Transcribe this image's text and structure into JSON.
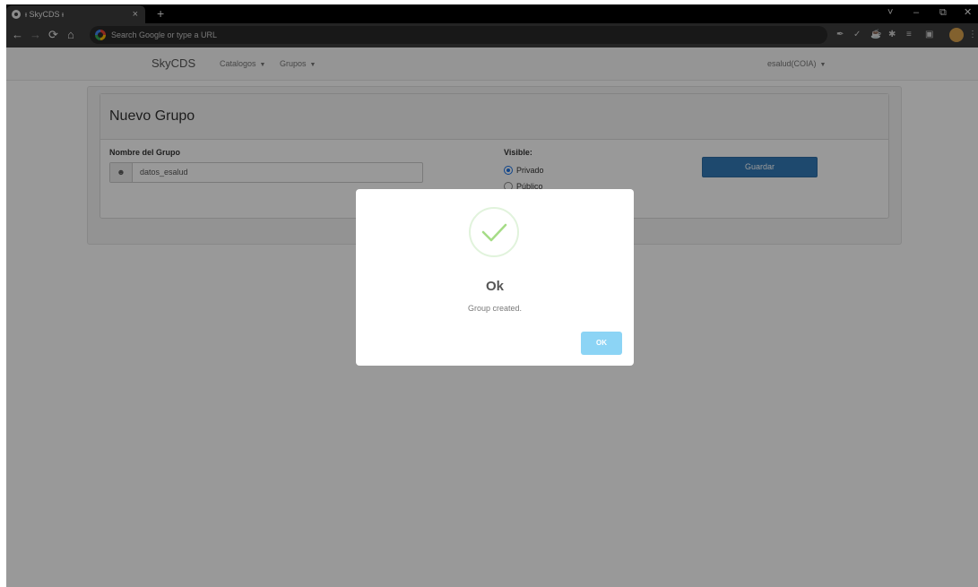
{
  "browser": {
    "tab_title": "ᵻ SkyCDS ᵻ",
    "tab_close": "×",
    "new_tab": "+",
    "address_placeholder": "Search Google or type a URL",
    "window_controls": [
      "˅",
      "–",
      "⧉",
      "✕"
    ]
  },
  "navbar": {
    "brand": "SkyCDS",
    "menu": [
      {
        "label": "Catalogos"
      },
      {
        "label": "Grupos"
      }
    ],
    "user": "esalud(COIA)"
  },
  "form": {
    "title": "Nuevo Grupo",
    "name_label": "Nombre del Grupo",
    "name_value": "datos_esalud",
    "visible_label": "Visible:",
    "options": [
      {
        "label": "Privado",
        "checked": true
      },
      {
        "label": "Público",
        "checked": false
      }
    ],
    "save_button": "Guardar"
  },
  "modal": {
    "title": "Ok",
    "message": "Group created.",
    "confirm_button": "OK"
  },
  "colors": {
    "primary": "#337ab7",
    "success": "#8cd4f5",
    "check": "#a5dc86"
  }
}
